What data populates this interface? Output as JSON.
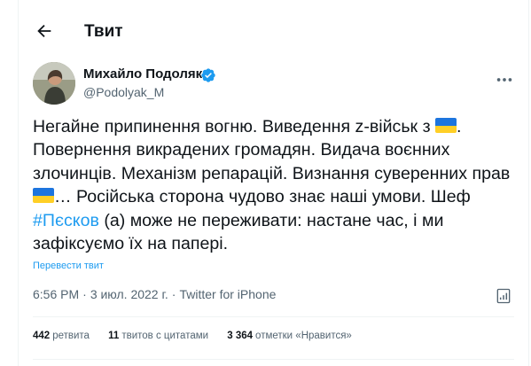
{
  "header": {
    "back_icon": "arrow-left-icon",
    "title": "Твит"
  },
  "author": {
    "name": "Михайло Подоляк",
    "handle": "@Podolyak_M",
    "verified_icon": "verified-badge-icon",
    "verified_color": "#1d9bf0"
  },
  "tweet": {
    "p1": "Негайне припинення вогню. Виведення z-військ з ",
    "p2": ". Повернення викрадених громадян. Видача воєнних злочинців. Механізм репарацій. Визнання суверенних прав ",
    "p3": "… Російська сторона чудово знає наші умови. Шеф ",
    "hashtag": "#Пєсков",
    "p4": " (а) може не переживати: настане час, і ми зафіксуємо їх на папері.",
    "flag_icon": "ukraine-flag-emoji",
    "flag_colors": [
      "#1d75de",
      "#ffcf26"
    ]
  },
  "translate_link": "Перевести твит",
  "meta": {
    "time": "6:56 PM",
    "date": "3 июл. 2022 г.",
    "source": "Twitter for iPhone",
    "separator": "·",
    "analytics_icon": "analytics-icon"
  },
  "stats": {
    "retweets_count": "442",
    "retweets_label": "ретвита",
    "quotes_count": "11",
    "quotes_label": "твитов с цитатами",
    "likes_count": "3 364",
    "likes_label": "отметки «Нравится»"
  },
  "colors": {
    "accent": "#1d9bf0",
    "text": "#0f1419",
    "secondary": "#536471"
  }
}
